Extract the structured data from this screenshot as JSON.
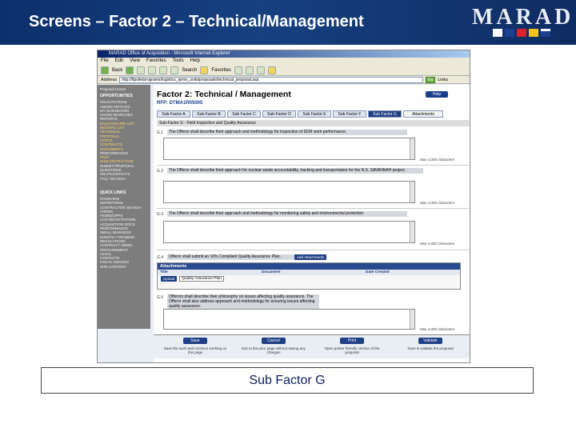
{
  "slide": {
    "title": "Screens – Factor 2 – Technical/Management",
    "logo_text": "MARAD",
    "caption": "Sub Factor G"
  },
  "browser": {
    "window_title": "MARAD Office of Acquisition - Microsoft Internet Explorer",
    "menu": [
      "File",
      "Edit",
      "View",
      "Favorites",
      "Tools",
      "Help"
    ],
    "toolbar_labels": {
      "back": "Back",
      "search": "Search",
      "favorites": "Favorites"
    },
    "address_label": "Address",
    "address_value": "http://ftpsite/programs/logistics_iprms_zoila/proposals/technical_proposal.asp",
    "go_label": "Go",
    "links_label": "Links"
  },
  "leftnav": {
    "top_label": "Proposal Center",
    "opportunities_head": "OPPORTUNITIES",
    "opportunities": [
      "SOLICITATIONS",
      "AWARD NOTICES",
      "MY DASHBOARD",
      "SAVED SEARCHES",
      "REPORTS",
      "BACKGROUND LIST",
      "BIDDERS LIST",
      "TECHNICAL",
      "PROPOSAL",
      "COSTS",
      "CONTRACTS",
      "DOCUMENTS",
      "PERFORMANCE",
      "PAST",
      "SUBCONTRACTING",
      "SUBMIT PROPOSAL",
      "QUESTIONS",
      "HELP/CONTACTS",
      "FAQ / SEARCH"
    ],
    "quicklinks_head": "QUICK LINKS",
    "quicklinks": [
      "OVERVIEW",
      "DEFINITIONS",
      "CONTRACTOR SEARCH",
      "FORMS",
      "FEDBIZOPPS",
      "CCR REGISTRATION",
      "ACQUISITION DOCS",
      "PERFORMANCE",
      "SMALL BUSINESS",
      "EVENTS / TRAINING",
      "REGULATIONS",
      "CONTRACT ADMIN",
      "PROCUREMENT",
      "LEGAL",
      "CONTACTS",
      "FISCAL AWARDS",
      "SITE CONTENT"
    ]
  },
  "main": {
    "page_title": "Factor 2: Technical / Management",
    "rfp_label": "RFP: DTMA1R05005",
    "help_label": "Help",
    "tabs": [
      {
        "label": "Sub-Factor A",
        "active": false
      },
      {
        "label": "Sub-Factor B",
        "active": false
      },
      {
        "label": "Sub Factor C",
        "active": false
      },
      {
        "label": "Sub-Factor D",
        "active": false
      },
      {
        "label": "Sub Factor E",
        "active": false
      },
      {
        "label": "Sub Factor F",
        "active": false
      },
      {
        "label": "Sub Factor G",
        "active": true
      },
      {
        "label": "Attachments",
        "active": false
      }
    ],
    "section_head": "Sub-Factor G - Field Inspection and Quality Assurance",
    "questions": [
      {
        "num": "G.1",
        "text": "The Offeror shall describe their approach and methodology for inspection of DDR work performance.",
        "limit": "Max 4,000 characters"
      },
      {
        "num": "G.2",
        "text": "The Offeror shall describe their approach for nuclear waste accountability, tracking and transportation for the N.S. SAVANNAH project.",
        "limit": "Max 4,000 characters"
      },
      {
        "num": "G.3",
        "text": "The Offeror shall describe their approach and methodology for monitoring safety and environmental protection.",
        "limit": "Max 4,000 characters"
      },
      {
        "num": "G.4",
        "text": "Offeror shall submit an 10% Compliant Quality Assurance Plan.",
        "limit": ""
      },
      {
        "num": "G.5",
        "text": "Offerors shall describe their philosophy on issues affecting quality assurance. The Offeror shall also address approach and methodology for ensuring issues affecting quality assurance.",
        "limit": "Max 4,000 characters"
      }
    ],
    "add_attachment_label": "Add Attachments",
    "attachments": {
      "title": "Attachments",
      "columns": [
        "Title",
        "Document",
        "Date Created"
      ],
      "upload_label": "Upload",
      "upload_value": "Quality Assurance Plan"
    },
    "footer": {
      "buttons": [
        {
          "label": "Save",
          "desc": "Save the work and continue working on this page"
        },
        {
          "label": "Cancel",
          "desc": "Exit to the prior page without saving any changes"
        },
        {
          "label": "Print",
          "desc": "Open printer friendly version of the proposal"
        },
        {
          "label": "Validate",
          "desc": "Save & validate the proposal"
        }
      ]
    }
  },
  "colors": {
    "header_bg": "#16407f",
    "active_tab": "#1f3f86",
    "nav_bg": "#7d7d7d",
    "caption_text": "#0d1e5e"
  }
}
